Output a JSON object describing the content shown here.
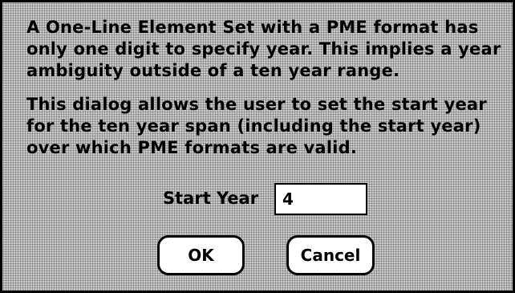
{
  "dialog": {
    "description_lines": [
      "A One-Line Element Set with a PME format has",
      "only one digit to specify year.  This implies a year",
      "ambiguity outside of a ten year range."
    ],
    "instruction_lines": [
      "This dialog allows the user to set the start year",
      "for the ten year span (including the start year)",
      "over which PME formats are valid."
    ],
    "start_year_label": "Start Year",
    "start_year_value": "4",
    "ok_label": "OK",
    "cancel_label": "Cancel"
  }
}
